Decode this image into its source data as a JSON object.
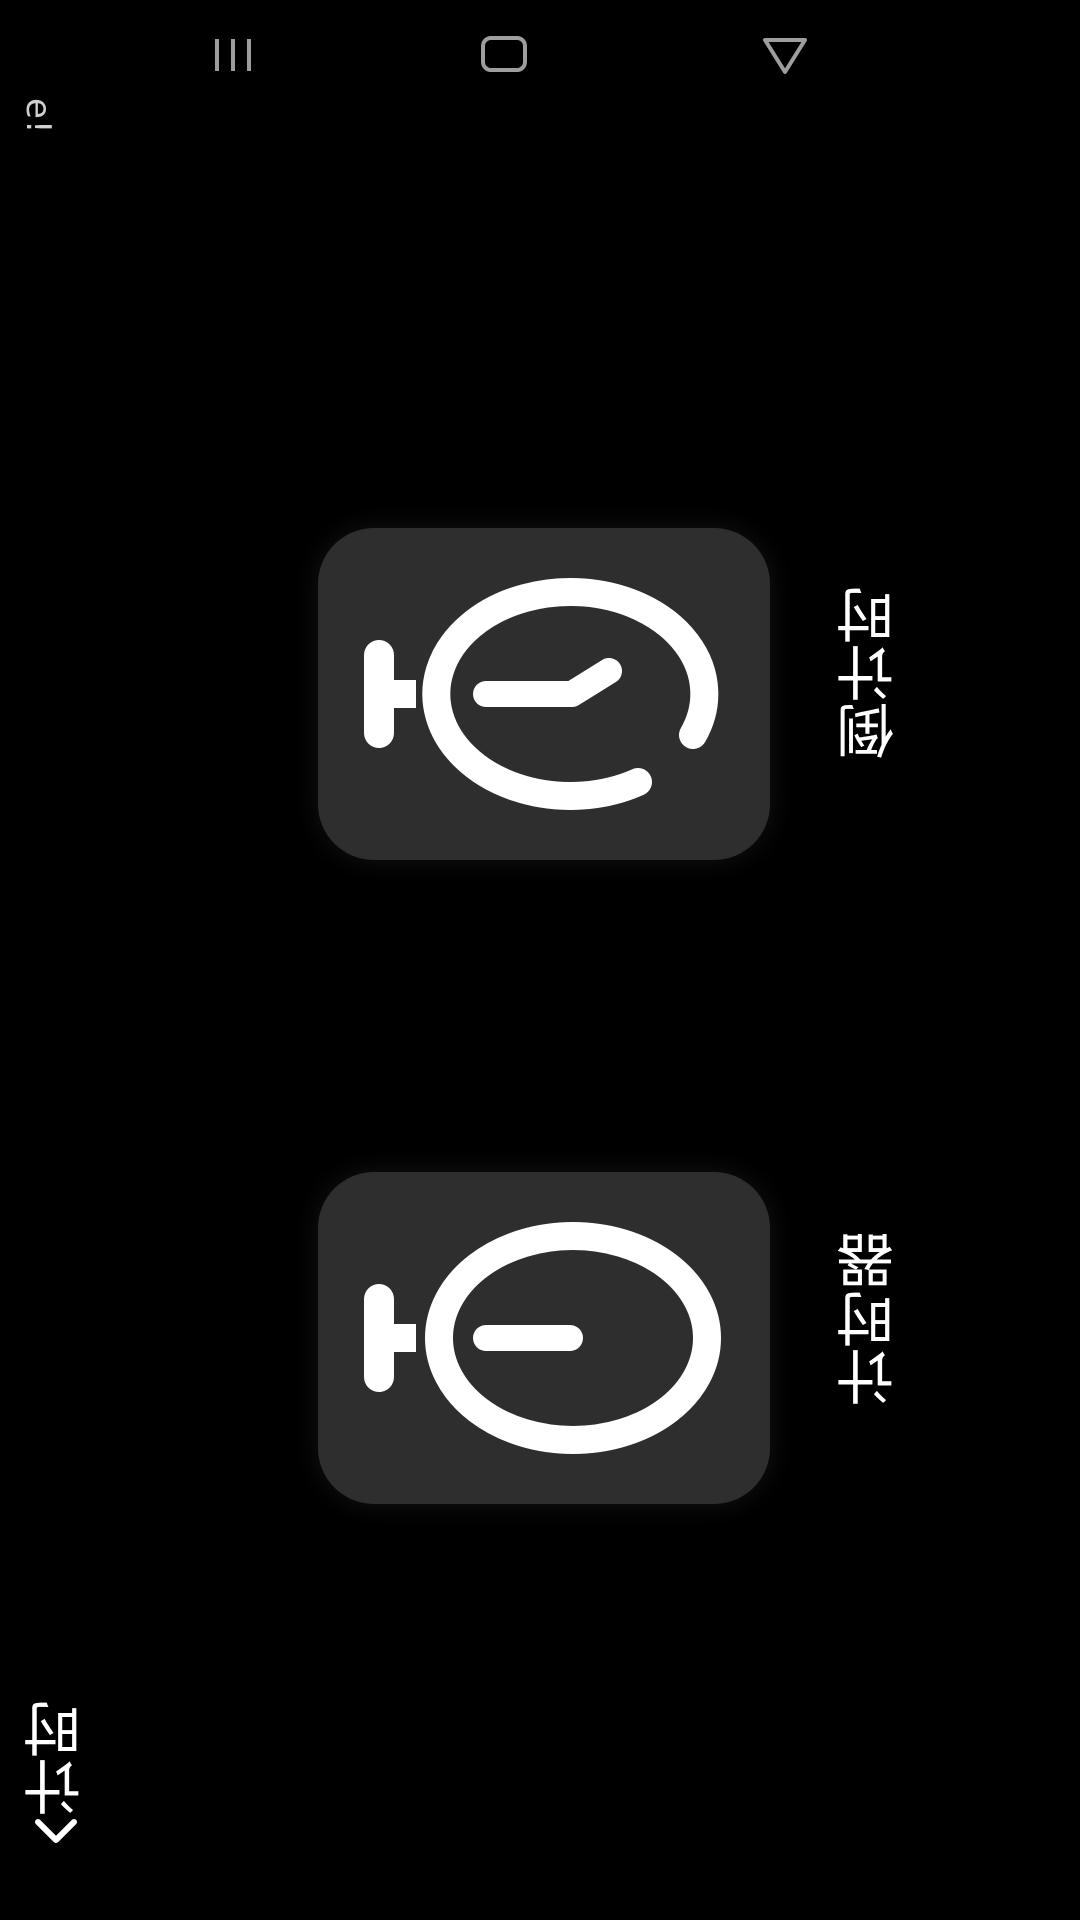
{
  "status_bar": {
    "partial_text": "e!"
  },
  "nav_bar": {
    "recents_icon": "recents-icon",
    "home_icon": "home-icon",
    "back_icon": "back-triangle-icon"
  },
  "tiles": [
    {
      "label": "倒计时",
      "icon": "countdown-timer-icon"
    },
    {
      "label": "计时器",
      "icon": "stopwatch-icon"
    }
  ],
  "header": {
    "title": "计时",
    "back_icon": "chevron-down-icon"
  },
  "colors": {
    "background": "#000000",
    "tile": "#2e2e2e",
    "foreground": "#ffffff"
  }
}
